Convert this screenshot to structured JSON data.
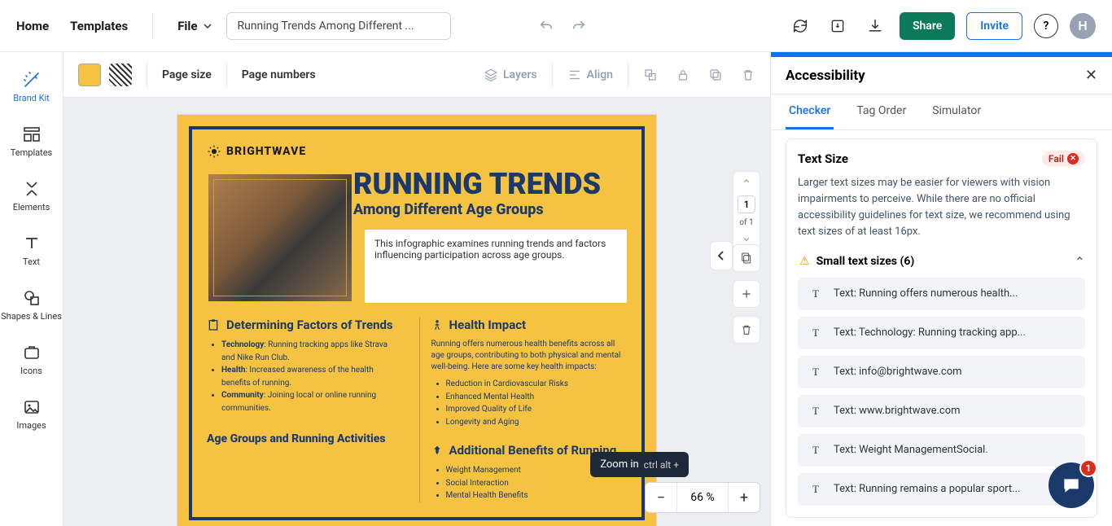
{
  "topbar": {
    "home": "Home",
    "templates": "Templates",
    "file": "File",
    "title_value": "Running Trends Among Different ...",
    "share": "Share",
    "invite": "Invite",
    "help": "?",
    "avatar_initial": "H"
  },
  "sidebar": {
    "items": [
      {
        "label": "Brand Kit"
      },
      {
        "label": "Templates"
      },
      {
        "label": "Elements"
      },
      {
        "label": "Text"
      },
      {
        "label": "Shapes & Lines"
      },
      {
        "label": "Icons"
      },
      {
        "label": "Images"
      }
    ]
  },
  "toolbar": {
    "page_size": "Page size",
    "page_numbers": "Page numbers",
    "layers": "Layers",
    "align": "Align"
  },
  "page_nav": {
    "current": "1",
    "of_text": "of 1"
  },
  "zoom": {
    "value": "66 %",
    "tooltip_label": "Zoom in",
    "tooltip_kbd": "ctrl alt +"
  },
  "doc": {
    "brand": "BRIGHTWAVE",
    "h1": "RUNNING TRENDS",
    "h2": "Among Different Age Groups",
    "intro": "This infographic examines running trends and factors influencing participation across age groups.",
    "determining_title": "Determining Factors of Trends",
    "determining_items": [
      {
        "b": "Technology",
        "rest": ": Running tracking apps like Strava and Nike Run Club."
      },
      {
        "b": "Health",
        "rest": ": Increased awareness of the health benefits of running."
      },
      {
        "b": "Community",
        "rest": ": Joining local or online running communities."
      }
    ],
    "age_groups_title": "Age Groups and Running Activities",
    "health_title": "Health Impact",
    "health_intro": "Running offers numerous health benefits across all age groups, contributing to both physical and mental well-being. Here are some key health impacts:",
    "health_items": [
      "Reduction in Cardiovascular Risks",
      "Enhanced Mental Health",
      "Improved Quality of Life",
      "Longevity and Aging"
    ],
    "additional_title": "Additional Benefits of Running",
    "additional_items": [
      "Weight Management",
      "Social Interaction",
      "Mental Health Benefits"
    ]
  },
  "panel": {
    "title": "Accessibility",
    "tabs": [
      "Checker",
      "Tag Order",
      "Simulator"
    ],
    "card_title": "Text Size",
    "card_status": "Fail",
    "card_desc": "Larger text sizes may be easier for viewers with vision impairments to perceive. While there are no official accessibility guidelines for text size, we recommend using text sizes of at least 16px.",
    "issue_group": "Small text sizes (6)",
    "issues": [
      "Text: Running offers numerous health...",
      "Text: Technology: Running tracking app...",
      "Text: info@brightwave.com",
      "Text: www.brightwave.com",
      "Text: Weight ManagementSocial.",
      "Text: Running remains a popular sport..."
    ]
  },
  "chat": {
    "badge": "1"
  }
}
